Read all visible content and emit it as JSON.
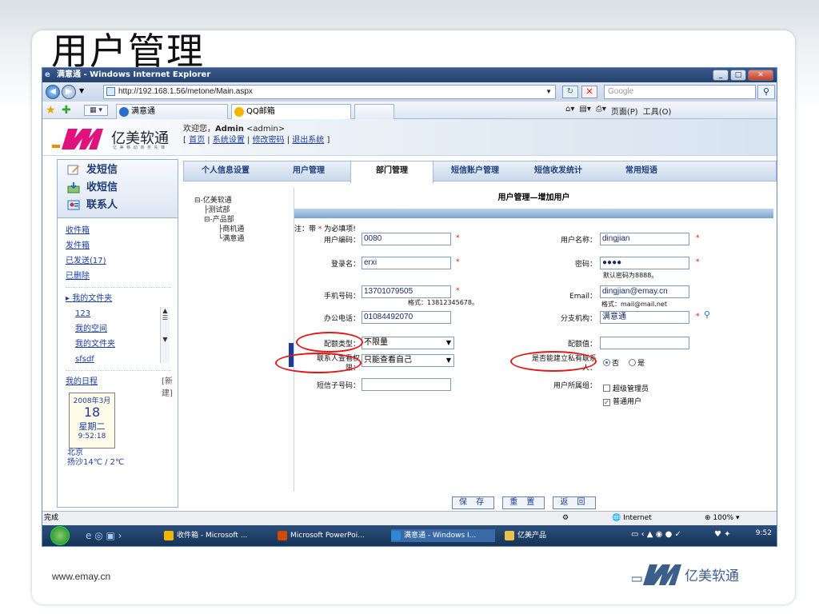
{
  "slide": {
    "title": "用户管理",
    "url": "www.emay.cn",
    "footer_logo": "亿美软通"
  },
  "window": {
    "title": "满意通 - Windows Internet Explorer",
    "address": "http://192.168.1.56/metone/Main.aspx",
    "search_placeholder": "Google",
    "tabs": [
      {
        "label": "满意通"
      },
      {
        "label": "QQ邮箱"
      }
    ],
    "cmd_page": "页面(P)",
    "cmd_tools": "工具(O)",
    "status_text": "完成",
    "zone": "Internet",
    "zoom": "100%"
  },
  "brand": {
    "name": "亿美软通",
    "sub": "亿 美 移 动 商 务 先 锋"
  },
  "welcome": {
    "greeting": "欢迎您，",
    "user": "Admin",
    "email": " <admin>",
    "links": [
      "首页",
      "系统设置",
      "修改密码",
      "退出系统"
    ]
  },
  "leftnav": {
    "buttons": [
      {
        "label": "发短信",
        "icon": "pen-icon"
      },
      {
        "label": "收短信",
        "icon": "inbox-icon"
      },
      {
        "label": "联系人",
        "icon": "contacts-icon"
      }
    ],
    "links": [
      "收件箱",
      "发件箱",
      "已发送(17)",
      "已删除"
    ],
    "folder_header": "我的文件夹",
    "folders": [
      "123",
      "我的空间",
      "我的文件夹",
      "sfsdf"
    ],
    "schedule": "我的日程",
    "schedule_new": "[新建]",
    "calendar": {
      "ym": "2008年3月",
      "day": "18",
      "weekday": "星期二",
      "time": "9:52:18",
      "city": "北京"
    },
    "weather": "扬沙14℃ / 2℃"
  },
  "maintabs": [
    {
      "label": "个人信息设置",
      "active": false
    },
    {
      "label": "用户管理",
      "active": false
    },
    {
      "label": "部门管理",
      "active": true
    },
    {
      "label": "短信账户管理",
      "active": false
    },
    {
      "label": "短信收发统计",
      "active": false
    },
    {
      "label": "常用短语",
      "active": false
    }
  ],
  "tree": {
    "root": "亿美软通",
    "test": "测试部",
    "product": "产品部",
    "p1": "商机通",
    "p2": "满意通"
  },
  "form": {
    "title": "用户管理—增加用户",
    "required_note_prefix": "注：带",
    "required_star": "*",
    "required_note_suffix": "为必填项!",
    "user_code_label": "用户编码：",
    "user_code": "0080",
    "user_name_label": "用户名称：",
    "user_name": "dingjian",
    "login_label": "登录名：",
    "login": "erxi",
    "password_label": "密码：",
    "password": "●●●●",
    "password_hint": "默认密码为8888。",
    "mobile_label": "手机号码：",
    "mobile": "13701079505",
    "mobile_hint": "格式：13812345678。",
    "email_label": "Email：",
    "email": "dingjian@emay.cn",
    "email_hint": "格式：mail@mail.net",
    "office_label": "办公电话：",
    "office": "01084492070",
    "branch_label": "分支机构：",
    "branch": "满意通",
    "quota_type_label": "配额类型：",
    "quota_type": "不限量",
    "quota_value_label": "配额值：",
    "quota_value": "",
    "contact_perm_label_1": "联系人查看权",
    "contact_perm_label_2": "限：",
    "contact_perm": "只能查看自己",
    "private_label_1": "是否能建立私有联系",
    "private_label_2": "人：",
    "private_no": "否",
    "private_yes": "是",
    "sms_sub_label": "短信子号码：",
    "sms_sub": "",
    "group_label": "用户所属组：",
    "group_super": "超级管理员",
    "group_normal": "普通用户",
    "save": "保 存",
    "reset": "重 置",
    "back": "返 回"
  },
  "taskbar": {
    "items": [
      "收件箱 - Microsoft ...",
      "Microsoft PowerPoi...",
      "满意通 - Windows I...",
      "亿美产品"
    ],
    "clock": "9:52"
  }
}
